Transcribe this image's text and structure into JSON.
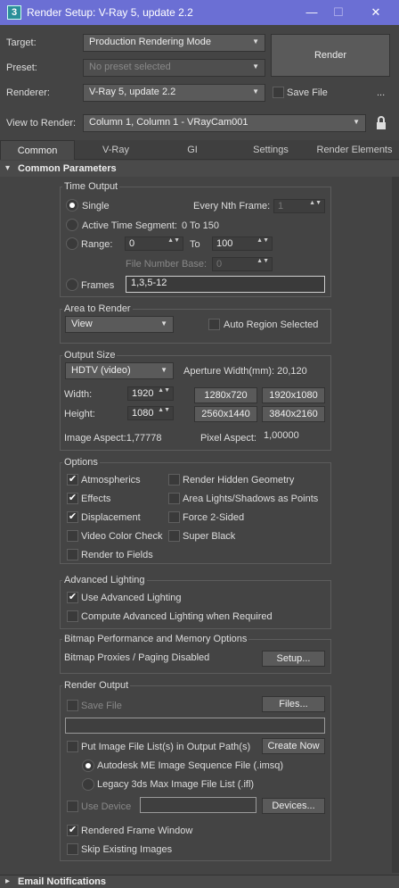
{
  "window": {
    "title": "Render Setup: V-Ray 5, update 2.2",
    "icon_label": "3",
    "minimize": "—",
    "maximize": "☐",
    "close": "✕"
  },
  "header": {
    "target_label": "Target:",
    "target_value": "Production Rendering Mode",
    "preset_label": "Preset:",
    "preset_value": "No preset selected",
    "renderer_label": "Renderer:",
    "renderer_value": "V-Ray 5, update 2.2",
    "save_file_label": "Save File",
    "more": "...",
    "view_label": "View to Render:",
    "view_value": "Column 1, Column 1 - VRayCam001",
    "render_button": "Render"
  },
  "tabs": [
    "Common",
    "V-Ray",
    "GI",
    "Settings",
    "Render Elements"
  ],
  "rollout": {
    "title": "Common Parameters",
    "email_title": "Email Notifications"
  },
  "time_output": {
    "title": "Time Output",
    "single": "Single",
    "every_nth": "Every Nth Frame:",
    "every_nth_value": "1",
    "active_segment": "Active Time Segment:",
    "active_segment_value": "0 To 150",
    "range": "Range:",
    "range_from": "0",
    "to": "To",
    "range_to": "100",
    "file_number_base": "File Number Base:",
    "file_number_base_value": "0",
    "frames": "Frames",
    "frames_value": "1,3,5-12"
  },
  "area_to_render": {
    "title": "Area to Render",
    "mode": "View",
    "auto_region": "Auto Region Selected"
  },
  "output_size": {
    "title": "Output Size",
    "preset": "HDTV (video)",
    "aperture": "Aperture Width(mm): 20,120",
    "width_label": "Width:",
    "width_value": "1920",
    "height_label": "Height:",
    "height_value": "1080",
    "presets": [
      "1280x720",
      "1920x1080",
      "2560x1440",
      "3840x2160"
    ],
    "image_aspect": "Image Aspect:1,77778",
    "pixel_aspect_label": "Pixel Aspect:",
    "pixel_aspect_value": "1,00000"
  },
  "options": {
    "title": "Options",
    "atmospherics": "Atmospherics",
    "effects": "Effects",
    "displacement": "Displacement",
    "video_color_check": "Video Color Check",
    "render_to_fields": "Render to Fields",
    "render_hidden": "Render Hidden Geometry",
    "area_lights": "Area Lights/Shadows as Points",
    "force_2_sided": "Force 2-Sided",
    "super_black": "Super Black"
  },
  "advanced_lighting": {
    "title": "Advanced Lighting",
    "use": "Use Advanced Lighting",
    "compute": "Compute Advanced Lighting when Required"
  },
  "bitmap": {
    "title": "Bitmap Performance and Memory Options",
    "status": "Bitmap Proxies / Paging Disabled",
    "setup": "Setup..."
  },
  "render_output": {
    "title": "Render Output",
    "save_file": "Save File",
    "files": "Files...",
    "put_image": "Put Image File List(s) in Output Path(s)",
    "create_now": "Create Now",
    "autodesk_seq": "Autodesk ME Image Sequence File (.imsq)",
    "legacy": "Legacy 3ds Max Image File List (.ifl)",
    "use_device": "Use Device",
    "devices": "Devices...",
    "rendered_frame_window": "Rendered Frame Window",
    "skip_existing": "Skip Existing Images"
  },
  "check_mark": "✔",
  "combo_arrow": "▼",
  "spin_arrows": "▲▼",
  "collapse_open": "▾",
  "collapse_closed": "▸",
  "lock_icon": "🔒",
  "colors": {
    "titlebar": "#6b6fd4",
    "panel": "#444444",
    "control": "#5a5a5a"
  }
}
